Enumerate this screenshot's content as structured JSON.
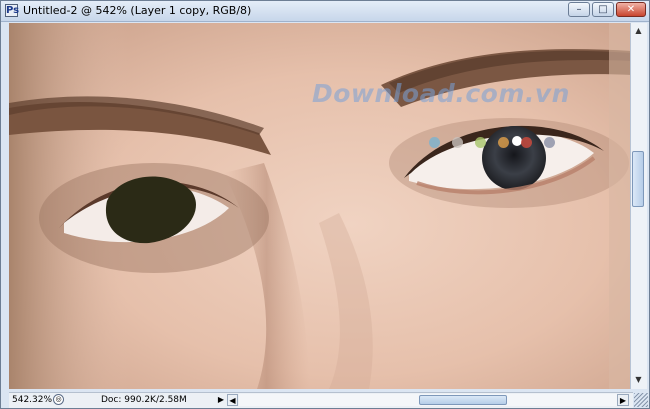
{
  "window": {
    "title": "Untitled-2 @ 542% (Layer 1 copy, RGB/8)",
    "app_icon_glyph": "Ps",
    "minimize_glyph": "–",
    "maximize_glyph": "□",
    "close_glyph": "✕"
  },
  "statusbar": {
    "zoom_level": "542.32%",
    "zoom_icon_glyph": "◎",
    "doc_size": "Doc: 990.2K/2.58M",
    "menu_arrow_glyph": "▶",
    "scroll_left_glyph": "◀",
    "scroll_right_glyph": "▶"
  },
  "scrollbar": {
    "up_glyph": "▲",
    "down_glyph": "▼"
  },
  "watermark": {
    "text": "Download.com.vn",
    "dot_colors": [
      "#7bb3cf",
      "#c9c2bd",
      "#a8c46a",
      "#e2a14a",
      "#d24b3d",
      "#8a8fa5",
      "#c7c7c7"
    ]
  },
  "colors": {
    "skin": "#e8c6b2",
    "brow": "#6b4a36",
    "eye_patch": "#2b2a16",
    "iris": "#3b3f47"
  }
}
